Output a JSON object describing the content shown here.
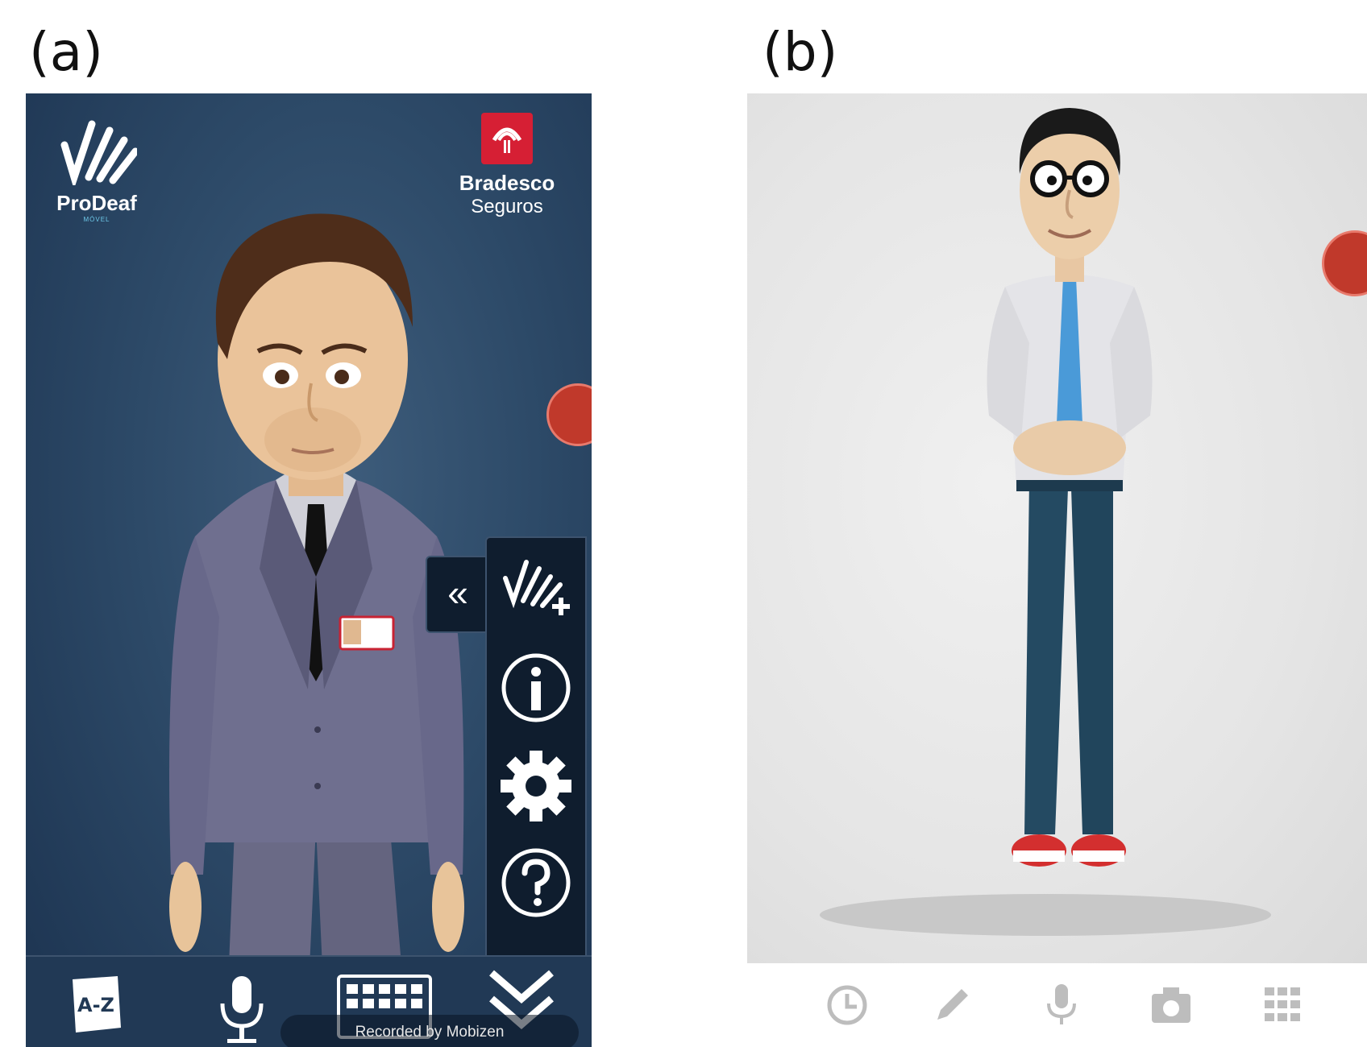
{
  "panel_a": {
    "label": "(a)",
    "prodeaf_logo": {
      "name": "ProDeaf",
      "sub": "MÓVEL"
    },
    "bradesco_logo": {
      "name": "Bradesco",
      "sub": "Seguros"
    },
    "side_menu": {
      "collapse_glyph": "«",
      "items": [
        "prodeaf-plus-icon",
        "info-icon",
        "settings-icon",
        "help-icon"
      ]
    },
    "bottom_bar": {
      "az_label": "A-Z",
      "items": [
        "dictionary-icon",
        "microphone-icon",
        "keyboard-icon",
        "expand-down-icon"
      ]
    },
    "watermark": "Recorded by Mobizen",
    "colors": {
      "background": "#2d4a68",
      "menu": "#0f1d2e",
      "brand_red": "#d61f34"
    }
  },
  "panel_b": {
    "label": "(b)",
    "bottom_bar": {
      "items": [
        "history-icon",
        "pencil-icon",
        "microphone-icon",
        "camera-icon",
        "grid-icon"
      ]
    },
    "colors": {
      "background": "#e6e6e6",
      "icons": "#bdbdbd"
    }
  }
}
